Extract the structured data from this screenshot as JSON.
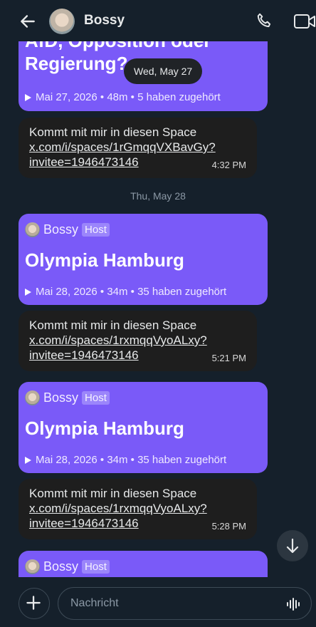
{
  "header": {
    "title": "Bossy",
    "icons": {
      "back": "arrow-left-icon",
      "call": "phone-icon",
      "video": "video-camera-icon"
    }
  },
  "floating_date": "Wed, May 27",
  "date_separator": "Thu, May 28",
  "cards": [
    {
      "title_partial_top": "AfD, Opposition oder",
      "title": "Regierung?",
      "meta": "Mai 27, 2026 • 48m • 5 haben zugehört"
    },
    {
      "host": "Bossy",
      "badge": "Host",
      "title": "Olympia Hamburg",
      "meta": "Mai 28, 2026 • 34m • 35 haben zugehört"
    },
    {
      "host": "Bossy",
      "badge": "Host",
      "title": "Olympia Hamburg",
      "meta": "Mai 28, 2026 • 34m • 35 haben zugehört"
    },
    {
      "host": "Bossy",
      "badge": "Host"
    }
  ],
  "messages": [
    {
      "text": "Kommt mit mir in diesen Space",
      "link1": "x.com/i/spaces/1rGmqqVXBavGy?",
      "link2": "invitee=1946473146",
      "time": "4:32 PM"
    },
    {
      "text": "Kommt mit mir in diesen Space",
      "link1": "x.com/i/spaces/1rxmqqVyoALxy?",
      "link2": "invitee=1946473146",
      "time": "5:21 PM"
    },
    {
      "text": "Kommt mit mir in diesen Space",
      "link1": "x.com/i/spaces/1rxmqqVyoALxy?",
      "link2": "invitee=1946473146",
      "time": "5:28 PM"
    }
  ],
  "composer": {
    "placeholder": "Nachricht"
  },
  "colors": {
    "background": "#15202b",
    "space_card": "#7a5af8",
    "bubble": "#1e1e1e"
  }
}
